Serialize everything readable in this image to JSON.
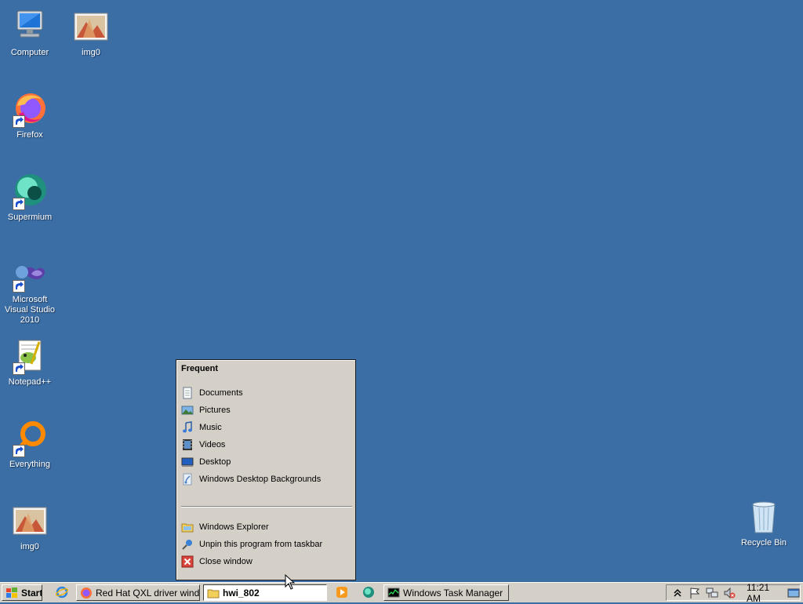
{
  "desktop": {
    "icons": [
      {
        "label": "Computer",
        "icon": "computer-icon"
      },
      {
        "label": "img0",
        "icon": "image-file-icon"
      },
      {
        "label": "Firefox",
        "icon": "firefox-icon"
      },
      {
        "label": "Supermium",
        "icon": "supermium-icon"
      },
      {
        "label": "Microsoft Visual Studio 2010",
        "icon": "visual-studio-icon"
      },
      {
        "label": "Notepad++",
        "icon": "notepadpp-icon"
      },
      {
        "label": "Everything",
        "icon": "everything-icon"
      },
      {
        "label": "img0",
        "icon": "image-file-icon"
      },
      {
        "label": "Recycle Bin",
        "icon": "recycle-bin-icon"
      }
    ]
  },
  "jumplist": {
    "header": "Frequent",
    "frequent": [
      {
        "label": "Documents",
        "icon": "documents-icon"
      },
      {
        "label": "Pictures",
        "icon": "pictures-icon"
      },
      {
        "label": "Music",
        "icon": "music-icon"
      },
      {
        "label": "Videos",
        "icon": "videos-icon"
      },
      {
        "label": "Desktop",
        "icon": "desktop-icon"
      },
      {
        "label": "Windows Desktop Backgrounds",
        "icon": "backgrounds-folder-icon"
      }
    ],
    "tasks": [
      {
        "label": "Windows Explorer",
        "icon": "explorer-icon"
      },
      {
        "label": "Unpin this program from taskbar",
        "icon": "unpin-icon"
      },
      {
        "label": "Close window",
        "icon": "close-window-icon"
      }
    ]
  },
  "taskbar": {
    "start_label": "Start",
    "buttons": [
      {
        "label": "Red Hat QXL driver wind...",
        "icon": "firefox-icon",
        "active": false
      },
      {
        "label": "hwi_802",
        "icon": "folder-icon",
        "active": true
      },
      {
        "label": "Windows Task Manager",
        "icon": "task-manager-icon",
        "active": false
      }
    ],
    "quick_launch": [
      "internet-explorer-icon",
      "media-player-icon",
      "supermium-icon"
    ],
    "tray": {
      "icons": [
        "show-hidden-icons-chevron-icon",
        "action-center-flag-icon",
        "network-icon",
        "volume-muted-icon",
        "show-desktop-icon"
      ],
      "clock": "11:21 AM"
    }
  }
}
